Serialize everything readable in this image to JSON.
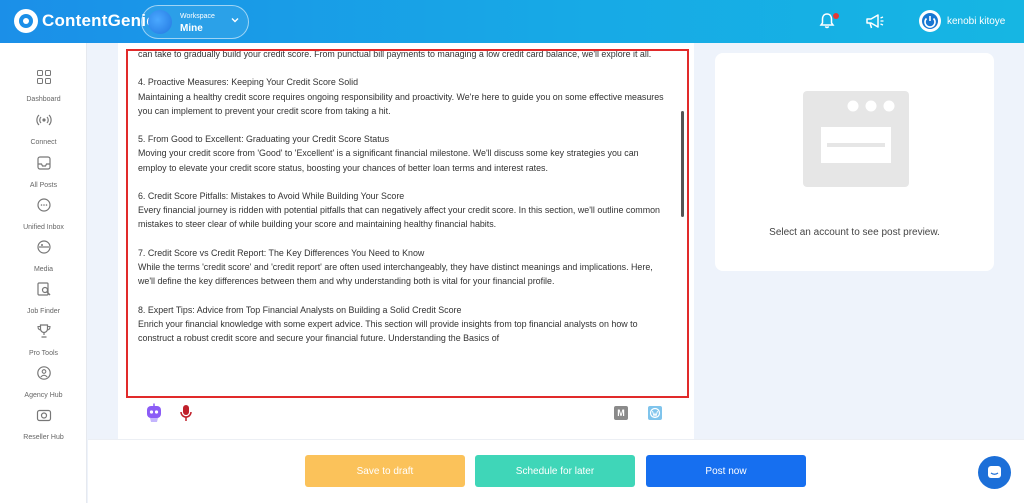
{
  "app": {
    "brand": "ContentGenie"
  },
  "workspace": {
    "caption": "Workspace",
    "name": "Mine"
  },
  "user": {
    "name": "kenobi kitoye"
  },
  "sidebar": {
    "items": [
      {
        "label": "Dashboard",
        "icon": "grid-icon"
      },
      {
        "label": "Connect",
        "icon": "broadcast-icon"
      },
      {
        "label": "All Posts",
        "icon": "inbox-tray-icon"
      },
      {
        "label": "Unified Inbox",
        "icon": "chat-bubble-icon"
      },
      {
        "label": "Media",
        "icon": "media-icon"
      },
      {
        "label": "Job Finder",
        "icon": "search-doc-icon"
      },
      {
        "label": "Pro Tools",
        "icon": "trophy-icon"
      },
      {
        "label": "Agency Hub",
        "icon": "people-icon"
      },
      {
        "label": "Reseller Hub",
        "icon": "camera-icon"
      }
    ]
  },
  "editor": {
    "paragraphs": [
      "can take to gradually build your credit score. From punctual bill payments to managing a low credit card balance, we'll explore it all.",
      "4. Proactive Measures: Keeping Your Credit Score Solid\nMaintaining a healthy credit score requires ongoing responsibility and proactivity. We're here to guide you on some effective measures you can implement to prevent your credit score from taking a hit.",
      "5. From Good to Excellent: Graduating your Credit Score Status\nMoving your credit score from 'Good' to 'Excellent' is a significant financial milestone. We'll discuss some key strategies you can employ to elevate your credit score status, boosting your chances of better loan terms and interest rates.",
      "6. Credit Score Pitfalls: Mistakes to Avoid While Building Your Score\nEvery financial journey is ridden with potential pitfalls that can negatively affect your credit score. In this section, we'll outline common mistakes to steer clear of while building your score and maintaining healthy financial habits.",
      "7. Credit Score vs Credit Report: The Key Differences You Need to Know\nWhile the terms 'credit score' and 'credit report' are often used interchangeably, they have distinct meanings and implications. Here, we'll define the key differences between them and why understanding both is vital for your financial profile.",
      "8. Expert Tips: Advice from Top Financial Analysts on Building a Solid Credit Score\nEnrich your financial knowledge with some expert advice. This section will provide insights from top financial analysts on how to construct a robust credit score and secure your financial future.  Understanding the Basics of"
    ],
    "icons": [
      "ai-assistant-icon",
      "microphone-icon",
      "medium-icon",
      "wordpress-icon"
    ],
    "medium_letter": "M"
  },
  "preview": {
    "message": "Select an account to see post preview."
  },
  "actions": {
    "draft": "Save to draft",
    "schedule": "Schedule for later",
    "post": "Post now"
  },
  "colors": {
    "header_start": "#1b8fe8",
    "header_end": "#16b6e3",
    "highlight_border": "#e12a2a",
    "draft_button": "#fbc25a",
    "schedule_button": "#3fd6b8",
    "post_button": "#166ff0"
  }
}
